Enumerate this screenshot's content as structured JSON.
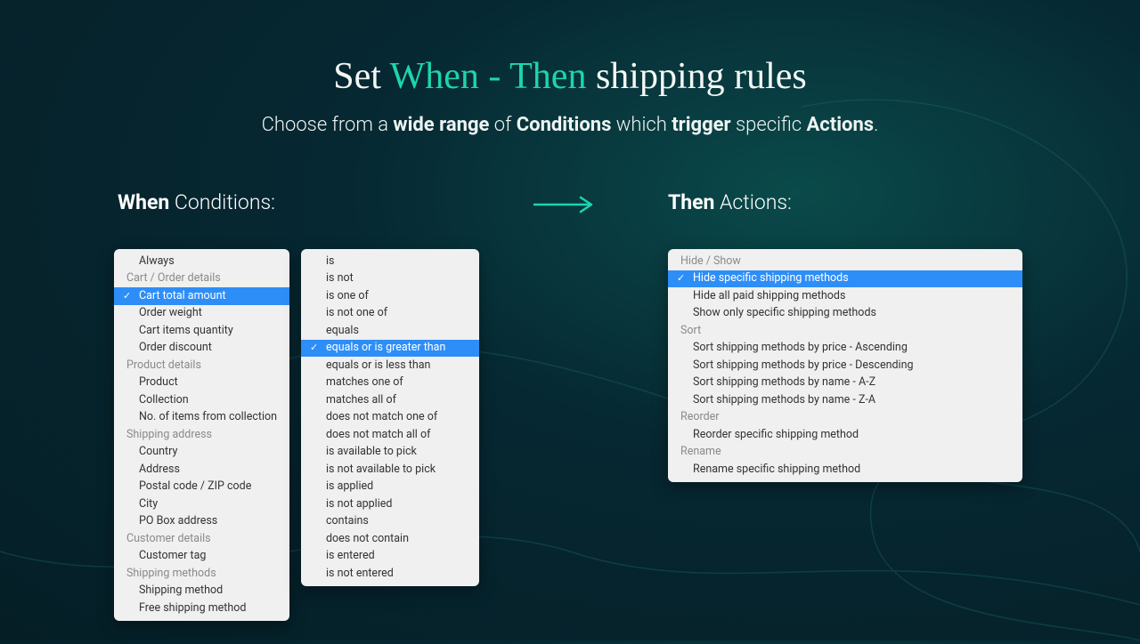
{
  "heading": {
    "pre": "Set ",
    "accent": "When - Then",
    "post": " shipping rules"
  },
  "subheading": {
    "t1": "Choose from a ",
    "b1": "wide range",
    "t2": " of ",
    "b2": "Conditions",
    "t3": " which ",
    "b3": "trigger",
    "t4": " specific ",
    "b4": "Actions",
    "t5": "."
  },
  "labels": {
    "when_b": "When",
    "when_t": " Conditions:",
    "then_b": "Then",
    "then_t": " Actions:"
  },
  "conditions": {
    "always": "Always",
    "g_cart": "Cart / Order details",
    "cart_total": "Cart total amount",
    "order_weight": "Order weight",
    "cart_qty": "Cart items quantity",
    "order_discount": "Order discount",
    "g_product": "Product details",
    "product": "Product",
    "collection": "Collection",
    "no_items_collection": "No. of items from collection",
    "g_shipaddr": "Shipping address",
    "country": "Country",
    "address": "Address",
    "postal": "Postal code / ZIP code",
    "city": "City",
    "pobox": "PO Box address",
    "g_customer": "Customer details",
    "customer_tag": "Customer tag",
    "g_shipmethods": "Shipping methods",
    "ship_method": "Shipping method",
    "free_ship": "Free shipping method"
  },
  "operators": {
    "is": "is",
    "is_not": "is not",
    "is_one_of": "is one of",
    "is_not_one_of": "is not one of",
    "equals": "equals",
    "eq_gte": "equals or is greater than",
    "eq_lte": "equals or is less than",
    "matches_one": "matches one of",
    "matches_all": "matches all of",
    "not_match_one": "does not match one of",
    "not_match_all": "does not match all of",
    "avail_pick": "is available to pick",
    "not_avail_pick": "is not available to pick",
    "is_applied": "is applied",
    "is_not_applied": "is not applied",
    "contains": "contains",
    "not_contain": "does not contain",
    "is_entered": "is entered",
    "is_not_entered": "is not entered"
  },
  "actions": {
    "g_hide": "Hide / Show",
    "hide_specific": "Hide specific shipping methods",
    "hide_all_paid": "Hide all paid shipping methods",
    "show_only": "Show only specific shipping methods",
    "g_sort": "Sort",
    "sort_price_asc": "Sort shipping methods by price - Ascending",
    "sort_price_desc": "Sort shipping methods by price - Descending",
    "sort_name_az": "Sort shipping methods by name - A-Z",
    "sort_name_za": "Sort shipping methods by name - Z-A",
    "g_reorder": "Reorder",
    "reorder_specific": "Reorder specific shipping method",
    "g_rename": "Rename",
    "rename_specific": "Rename specific shipping method"
  },
  "colors": {
    "accent": "#1ed4b0",
    "selection": "#2e8ef7"
  }
}
